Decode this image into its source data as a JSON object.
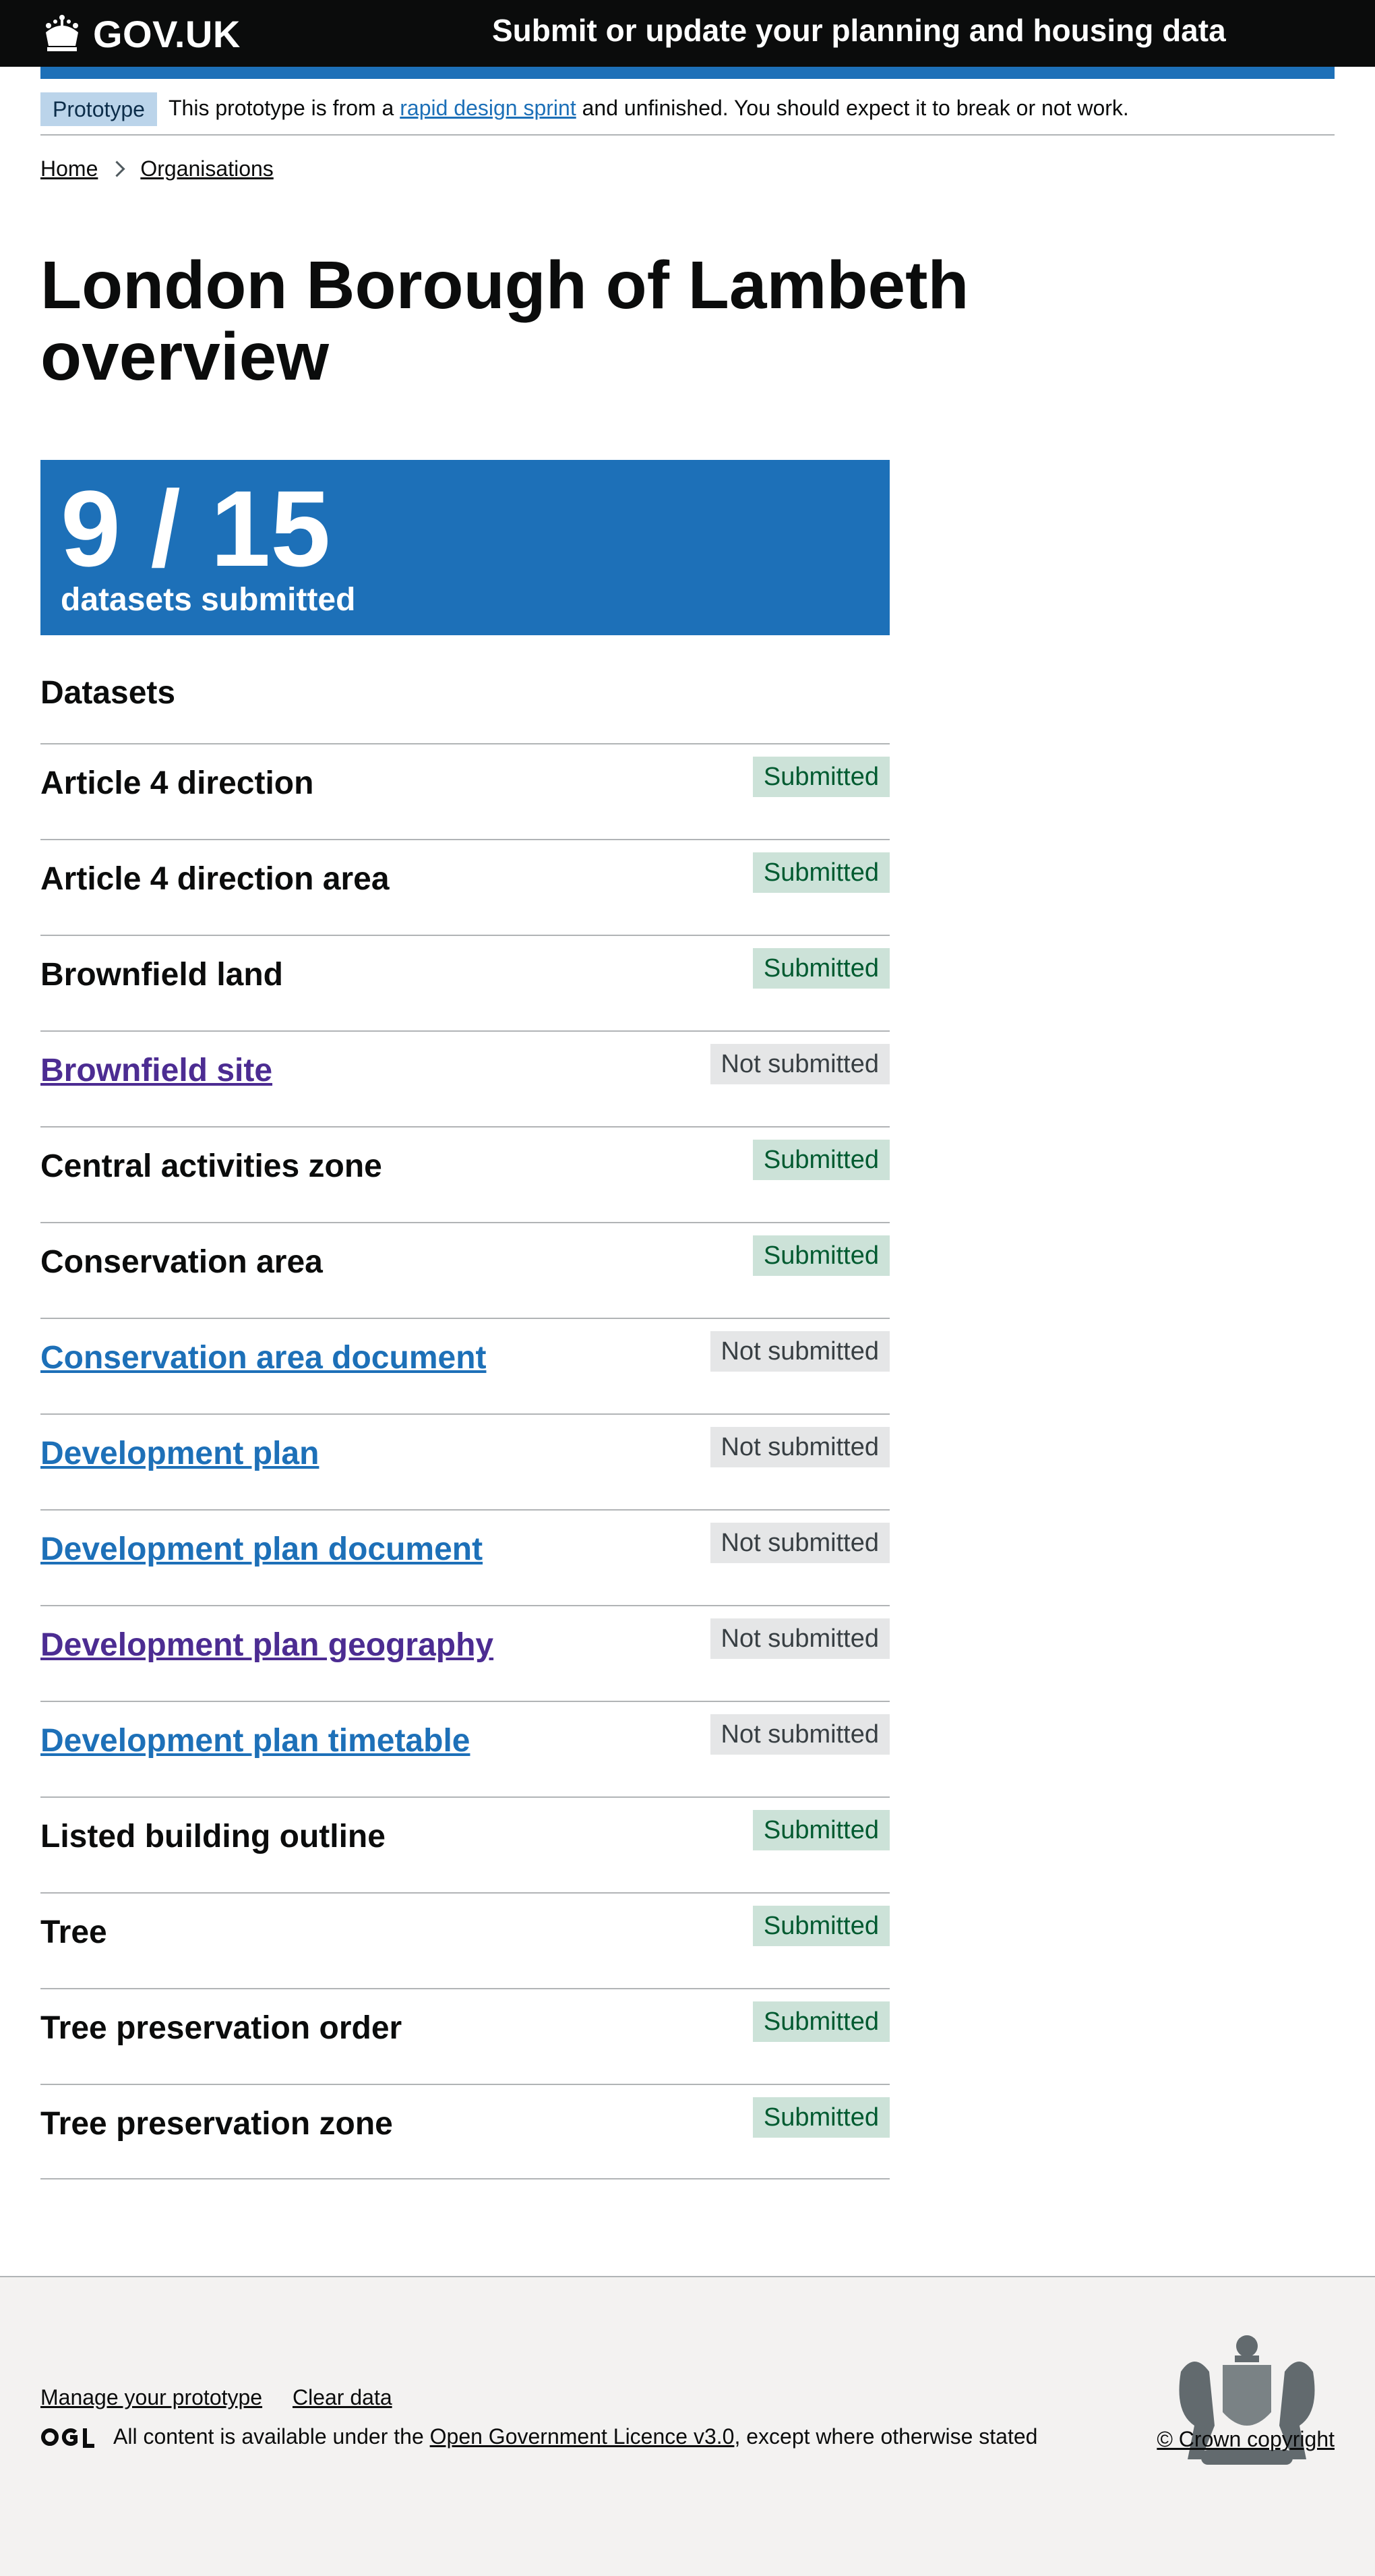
{
  "header": {
    "logo_text": "GOV.UK",
    "service_name": "Submit or update your planning and housing data"
  },
  "phase": {
    "tag": "Prototype",
    "text_before": "This prototype is from a",
    "link": "rapid design sprint",
    "text_after": "and unfinished. You should expect it to break or not work."
  },
  "breadcrumbs": [
    "Home",
    "Organisations"
  ],
  "title": "London Borough of Lambeth overview",
  "stats": {
    "count": "9 / 15",
    "label": "datasets submitted"
  },
  "datasets_heading": "Datasets",
  "datasets": [
    {
      "name": "Article 4 direction",
      "status": "Submitted",
      "state": "ok",
      "style": "plain"
    },
    {
      "name": "Article 4 direction area",
      "status": "Submitted",
      "state": "ok",
      "style": "plain"
    },
    {
      "name": "Brownfield land",
      "status": "Submitted",
      "state": "ok",
      "style": "plain"
    },
    {
      "name": "Brownfield site",
      "status": "Not submitted",
      "state": "no",
      "style": "visited"
    },
    {
      "name": "Central activities zone",
      "status": "Submitted",
      "state": "ok",
      "style": "plain"
    },
    {
      "name": "Conservation area",
      "status": "Submitted",
      "state": "ok",
      "style": "plain"
    },
    {
      "name": "Conservation area document",
      "status": "Not submitted",
      "state": "no",
      "style": "link"
    },
    {
      "name": "Development plan",
      "status": "Not submitted",
      "state": "no",
      "style": "link"
    },
    {
      "name": "Development plan document",
      "status": "Not submitted",
      "state": "no",
      "style": "link"
    },
    {
      "name": "Development plan geography",
      "status": "Not submitted",
      "state": "no",
      "style": "visited"
    },
    {
      "name": "Development plan timetable",
      "status": "Not submitted",
      "state": "no",
      "style": "link"
    },
    {
      "name": "Listed building outline",
      "status": "Submitted",
      "state": "ok",
      "style": "plain"
    },
    {
      "name": "Tree",
      "status": "Submitted",
      "state": "ok",
      "style": "plain"
    },
    {
      "name": "Tree preservation order",
      "status": "Submitted",
      "state": "ok",
      "style": "plain"
    },
    {
      "name": "Tree preservation zone",
      "status": "Submitted",
      "state": "ok",
      "style": "plain"
    }
  ],
  "footer": {
    "links": [
      "Manage your prototype",
      "Clear data"
    ],
    "licence_before": "All content is available under the",
    "licence_link": "Open Government Licence v3.0",
    "licence_after": ", except where otherwise stated",
    "copyright": "© Crown copyright"
  },
  "colors": {
    "header_bg": "#0b0c0c",
    "accent": "#1d70b8",
    "submitted_bg": "#cce2d8",
    "submitted_text": "#005a30",
    "not_submitted_bg": "#e5e6e7",
    "visited_link": "#4c2c92"
  },
  "icons": [
    "crown-icon",
    "chevron-right-icon",
    "ogl-logo-icon",
    "royal-coat-of-arms-icon"
  ]
}
